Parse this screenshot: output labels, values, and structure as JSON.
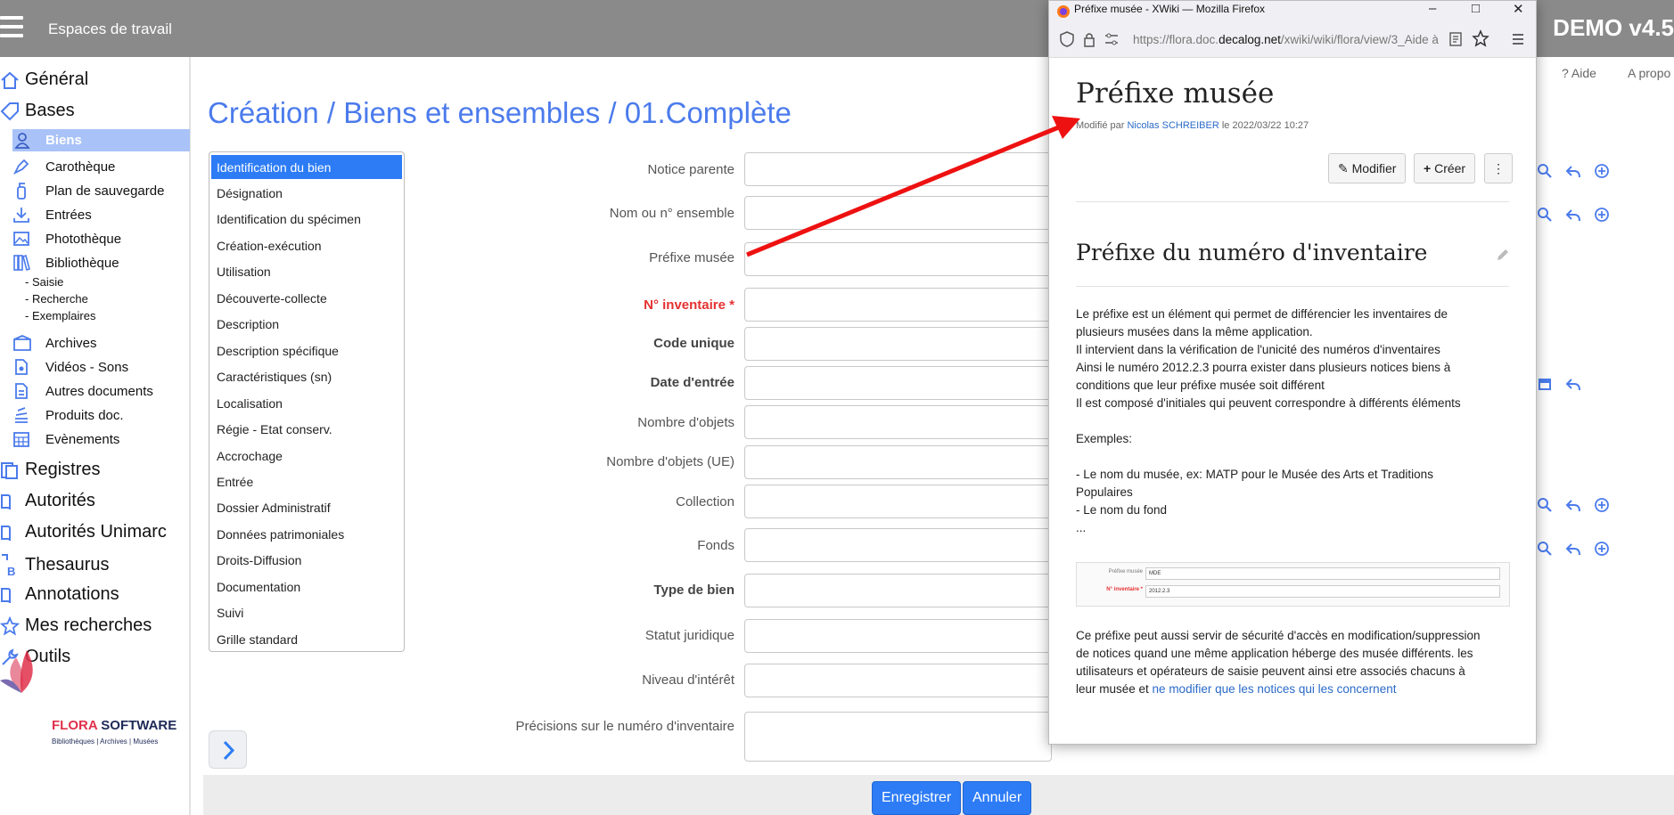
{
  "topbar": {
    "workspace_title": "Espaces de travail",
    "version": "DEMO v4.5"
  },
  "utility": {
    "help": "? Aide",
    "about": "A propo"
  },
  "sidebar": {
    "top_items": [
      "Général",
      "Bases"
    ],
    "base_items": [
      "Biens",
      "Carothèque",
      "Plan de sauvegarde",
      "Entrées",
      "Photothèque",
      "Bibliothèque"
    ],
    "bib_items": [
      "- Saisie",
      "- Recherche",
      "- Exemplaires"
    ],
    "more_base_items": [
      "Archives",
      "Vidéos - Sons",
      "Autres documents",
      "Produits doc.",
      "Evènements"
    ],
    "bottom_items": [
      "Registres",
      "Autorités",
      "Autorités Unimarc",
      "Thesaurus",
      "Annotations",
      "Mes recherches",
      "Outils"
    ]
  },
  "logo": {
    "brand_part1": "FLORA",
    "brand_part2": " SOFTWARE",
    "subtitle": "Bibliothèques | Archives | Musées"
  },
  "page": {
    "title": "Création / Biens et ensembles / 01.Complète"
  },
  "sections": [
    "Identification du bien",
    "Désignation",
    "Identification du spécimen",
    "Création-exécution",
    "Utilisation",
    "Découverte-collecte",
    "Description",
    "Description spécifique",
    "Caractéristiques (sn)",
    "Localisation",
    "Régie - Etat conserv.",
    "Accrochage",
    "Entrée",
    "Dossier Administratif",
    "Données patrimoniales",
    "Droits-Diffusion",
    "Documentation",
    "Suivi",
    "Grille standard"
  ],
  "fields": [
    {
      "label": "Notice parente",
      "style": "normal"
    },
    {
      "label": "Nom ou n° ensemble",
      "style": "normal"
    },
    {
      "label": "Préfixe musée",
      "style": "normal"
    },
    {
      "label": "N° inventaire *",
      "style": "req"
    },
    {
      "label": "Code unique",
      "style": "bold"
    },
    {
      "label": "Date d'entrée",
      "style": "bold"
    },
    {
      "label": "Nombre d'objets",
      "style": "normal"
    },
    {
      "label": "Nombre d'objets (UE)",
      "style": "normal"
    },
    {
      "label": "Collection",
      "style": "normal"
    },
    {
      "label": "Fonds",
      "style": "normal"
    },
    {
      "label": "Type de bien",
      "style": "bold"
    },
    {
      "label": "Statut juridique",
      "style": "normal"
    },
    {
      "label": "Niveau d'intérêt",
      "style": "normal"
    },
    {
      "label": "Précisions sur le numéro d'inventaire",
      "style": "normal"
    }
  ],
  "buttons": {
    "save": "Enregistrer",
    "cancel": "Annuler"
  },
  "popup": {
    "window_title": "Préfixe musée - XWiki — Mozilla Firefox",
    "url_prefix": "https://flora.doc.",
    "url_domain": "decalog.net",
    "url_rest": "/xwiki/wiki/flora/view/3_Aide à",
    "doc_title": "Préfixe musée",
    "meta_prefix": "Modifié par ",
    "meta_author": "Nicolas SCHREIBER",
    "meta_suffix": " le 2022/03/22 10:27",
    "btn_edit": "Modifier",
    "btn_create": "Créer",
    "heading": "Préfixe du numéro d'inventaire",
    "para1": [
      "Le préfixe est un élément qui permet de différencier les inventaires de",
      "plusieurs musées dans la même application.",
      "Il intervient dans la vérification de l'unicité des numéros d'inventaires",
      "Ainsi le numéro 2012.2.3 pourra exister dans plusieurs notices biens à",
      "conditions que leur préfixe musée soit différent",
      "Il est composé d'initiales qui peuvent correspondre à différents éléments"
    ],
    "examples_title": "Exemples:",
    "examples": [
      "- Le nom du musée, ex: MATP pour le Musée des Arts et Traditions",
      "Populaires",
      "- Le nom du fond",
      "..."
    ],
    "mini_label1": "Préfixe musée",
    "mini_value1": "MDE",
    "mini_label2": "N° inventaire *",
    "mini_value2": "2012.2.3",
    "para2": [
      "Ce préfixe peut aussi servir de sécurité d'accès en modification/suppression",
      "de notices quand une même application héberge des musée différents. les",
      "utilisateurs et opérateurs de saisie peuvent ainsi etre associés chacuns à"
    ],
    "para2_last_prefix": "leur musée et ",
    "para2_link": "ne modifier que les notices qui les concernent"
  },
  "colors": {
    "accent": "#2d7cf6",
    "title": "#4b7bec",
    "required": "#e53131",
    "arrow": "#ee1111"
  }
}
